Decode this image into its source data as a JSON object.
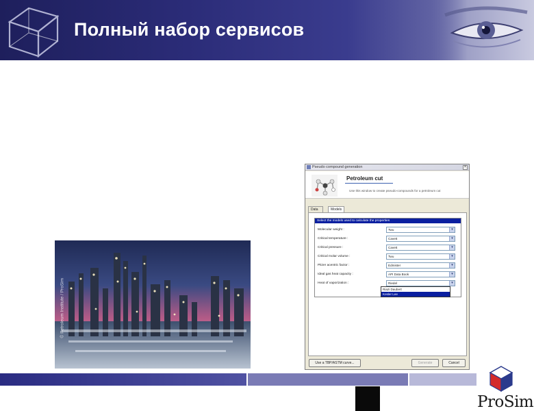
{
  "slide": {
    "title": "Полный набор сервисов"
  },
  "photo": {
    "caption": "© Petroleum Institute / ProSim"
  },
  "dialog": {
    "window_title": "Pseudo compound generation",
    "heading": "Petroleum cut",
    "description": "Use this window to create pseudo-compounds for a petroleum cut",
    "tabs": [
      "Data",
      "Models"
    ],
    "group_header": "Select the models used to calculate the properties",
    "rows": [
      {
        "label": "Molecular weight :",
        "value": "Twu"
      },
      {
        "label": "Critical temperature :",
        "value": "Cavett"
      },
      {
        "label": "Critical pressure :",
        "value": "Cavett"
      },
      {
        "label": "Critical molar volume :",
        "value": "Twu"
      },
      {
        "label": "Pitzer acentric factor :",
        "value": "Edmister"
      },
      {
        "label": "Ideal gas heat capacity :",
        "value": "API Data Book"
      },
      {
        "label": "Heat of vaporization :",
        "value": "Riedel"
      }
    ],
    "dropdown_options": [
      "Riazi Daubert",
      "Kesler Lee"
    ],
    "dropdown_active_index": 1,
    "buttons": {
      "left": "Use a TBP/ASTM curve...",
      "ok": "Generate",
      "cancel": "Cancel"
    },
    "close_glyph": "×"
  },
  "logo": {
    "name": "ProSim"
  },
  "colors": {
    "banner_dark": "#1e1f5c",
    "accent_blue": "#0a1fa0",
    "logo_red": "#d42a2a",
    "logo_blue": "#2b3a8c"
  }
}
